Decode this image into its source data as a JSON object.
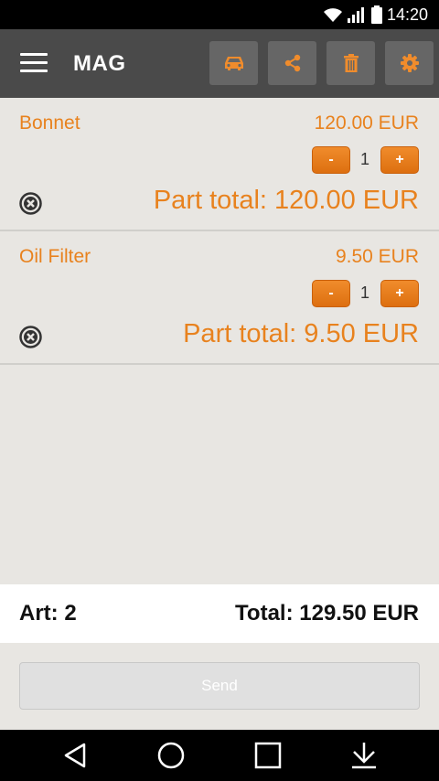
{
  "status_bar": {
    "time": "14:20"
  },
  "app_bar": {
    "title": "MAG",
    "actions": [
      {
        "icon": "car-icon"
      },
      {
        "icon": "share-icon"
      },
      {
        "icon": "trash-icon"
      },
      {
        "icon": "gear-icon"
      }
    ]
  },
  "items": [
    {
      "name": "Bonnet",
      "price": "120.00 EUR",
      "quantity": "1",
      "minus_label": "-",
      "plus_label": "+",
      "part_total": "Part total: 120.00 EUR"
    },
    {
      "name": "Oil Filter",
      "price": "9.50 EUR",
      "quantity": "1",
      "minus_label": "-",
      "plus_label": "+",
      "part_total": "Part total: 9.50 EUR"
    }
  ],
  "summary": {
    "articles": "Art: 2",
    "total": "Total: 129.50 EUR"
  },
  "send_label": "Send",
  "colors": {
    "accent": "#e8821e",
    "app_bar": "#4a4a4a",
    "background": "#e8e6e2"
  }
}
